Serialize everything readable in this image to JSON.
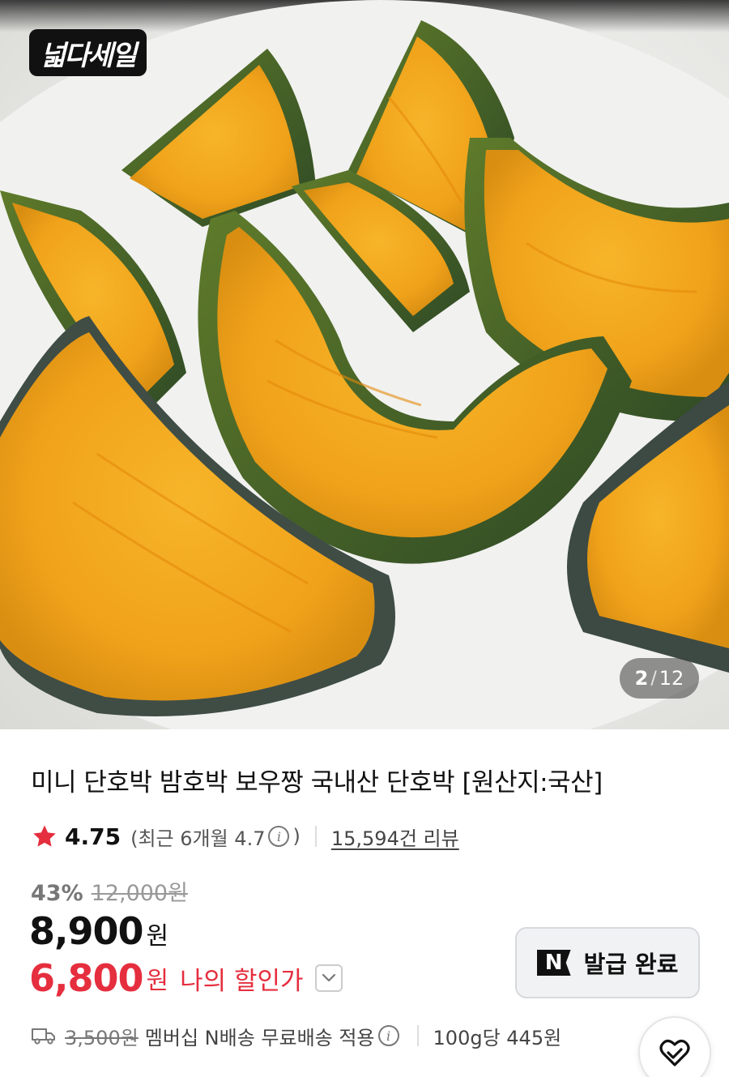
{
  "hero": {
    "badge_text": "넓다세일",
    "counter_current": "2",
    "counter_separator": "/",
    "counter_total": "12"
  },
  "product": {
    "title": "미니 단호박 밤호박 보우짱 국내산 단호박 [원산지:국산]",
    "rating_value": "4.75",
    "rating_recent_text": "(최근 6개월 4.7",
    "rating_recent_close": ")",
    "review_count_text": "15,594건 리뷰",
    "discount_rate": "43%",
    "original_price": "12,000원",
    "price": "8,900",
    "price_unit": "원",
    "my_price": "6,800",
    "my_price_unit": "원",
    "my_price_label": "나의 할인가"
  },
  "coupon": {
    "icon_letter": "N",
    "label": "발급 완료"
  },
  "shipping": {
    "original_fee": "3,500원",
    "description": "멤버십 N배송 무료배송 적용",
    "per_unit_price": "100g당 445원"
  },
  "colors": {
    "accent_red": "#e52e3e",
    "star": "#e52e3e"
  }
}
